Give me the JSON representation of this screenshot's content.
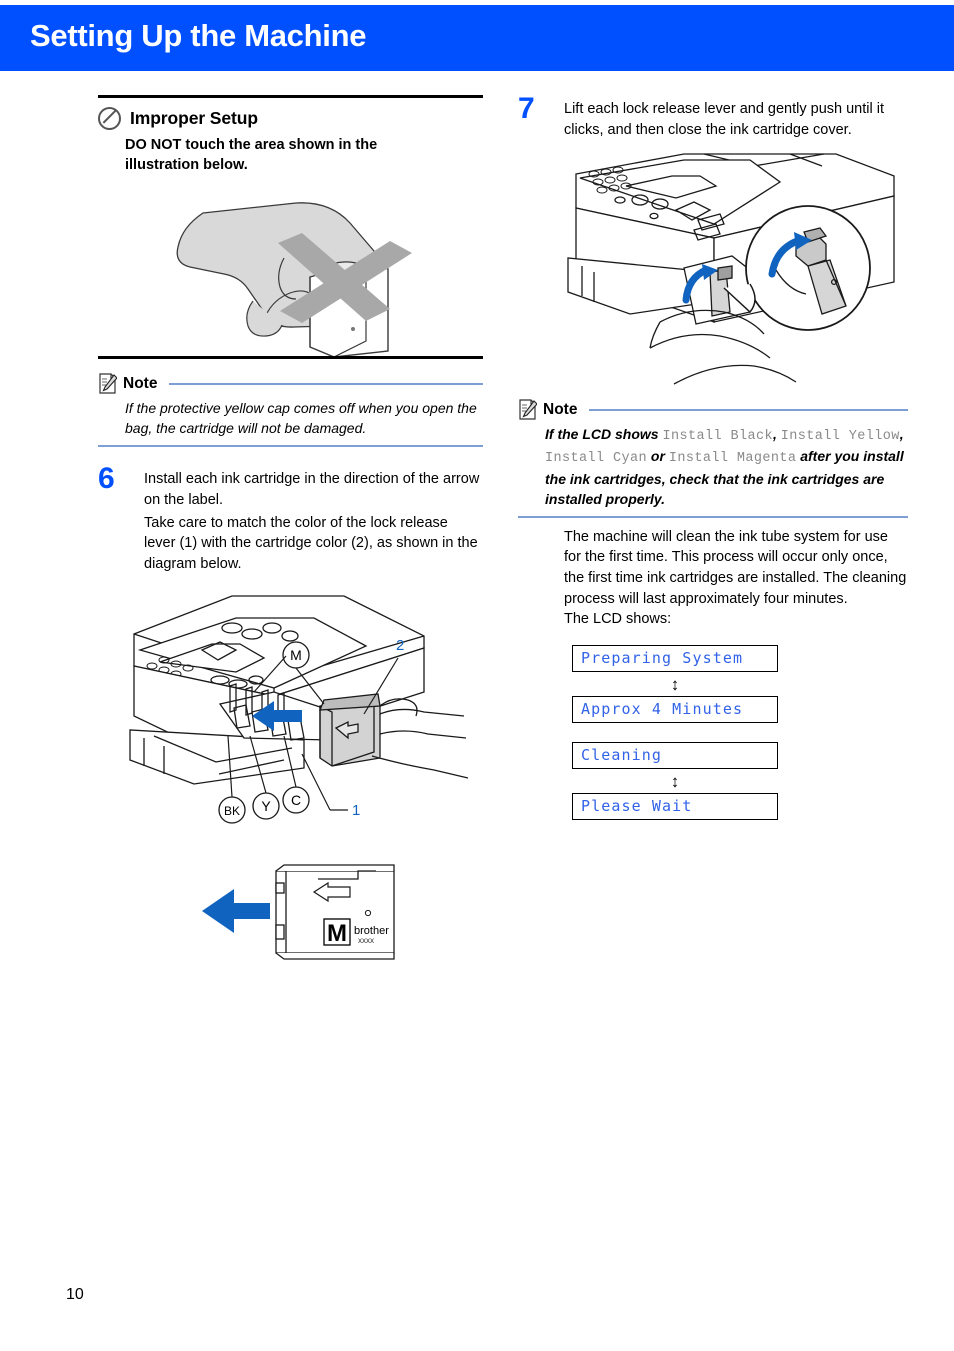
{
  "header": {
    "title": "Setting Up the Machine",
    "bar_color": "#0050ff"
  },
  "left_column": {
    "improper_setup": {
      "icon": "prohibition-icon",
      "title": "Improper Setup",
      "body": "DO NOT touch the area shown in the illustration below."
    },
    "illustration_hand": {
      "name": "hand-holding-cartridge-do-not-touch",
      "caption": ""
    },
    "note": {
      "icon": "note-pencil-icon",
      "label": "Note",
      "body": "If the protective yellow cap comes off when you open the bag, the cartridge will not be damaged."
    },
    "step6": {
      "number": "6",
      "text_line1": "Install each ink cartridge in the direction of the arrow on the label.",
      "text_line2": "Take care to match the color of the lock release lever (1) with the cartridge color (2), as shown in the diagram below."
    },
    "illustration_printer": {
      "name": "printer-ink-cartridge-slots",
      "labels": [
        "M",
        "BK",
        "Y",
        "C"
      ],
      "callouts": [
        "1",
        "2"
      ]
    },
    "illustration_cartridge": {
      "name": "magenta-cartridge-label",
      "letter": "M",
      "brand": "brother",
      "model": "XXXX"
    }
  },
  "right_column": {
    "step7": {
      "number": "7",
      "text": "Lift each lock release lever and gently push until it clicks, and then close the ink cartridge cover."
    },
    "illustration_lever": {
      "name": "printer-lock-release-lever-detail"
    },
    "note": {
      "icon": "note-pencil-icon",
      "label": "Note",
      "prefix": "If the LCD shows ",
      "lcd_terms": [
        "Install Black",
        "Install Yellow",
        "Install Cyan",
        "Install Magenta"
      ],
      "joiner_comma": ",",
      "joiner_or": "or",
      "suffix": "after you install the ink cartridges, check that the ink cartridges are installed properly."
    },
    "body_paragraph": "The machine will clean the ink tube system for use for the first time. This process will occur only once, the first time ink cartridges are installed. The cleaning process will last approximately four minutes.",
    "lcd_intro": "The LCD shows:",
    "lcd_messages": [
      {
        "text": "Preparing System",
        "arrow_after": true
      },
      {
        "text": "Approx 4 Minutes",
        "arrow_after": false
      },
      {
        "text": "Cleaning",
        "arrow_after": true
      },
      {
        "text": "Please Wait",
        "arrow_after": false
      }
    ],
    "lcd_arrow_glyph": "↕",
    "lcd_text_color": "#3163e8"
  },
  "footer": {
    "page_number": "10"
  }
}
